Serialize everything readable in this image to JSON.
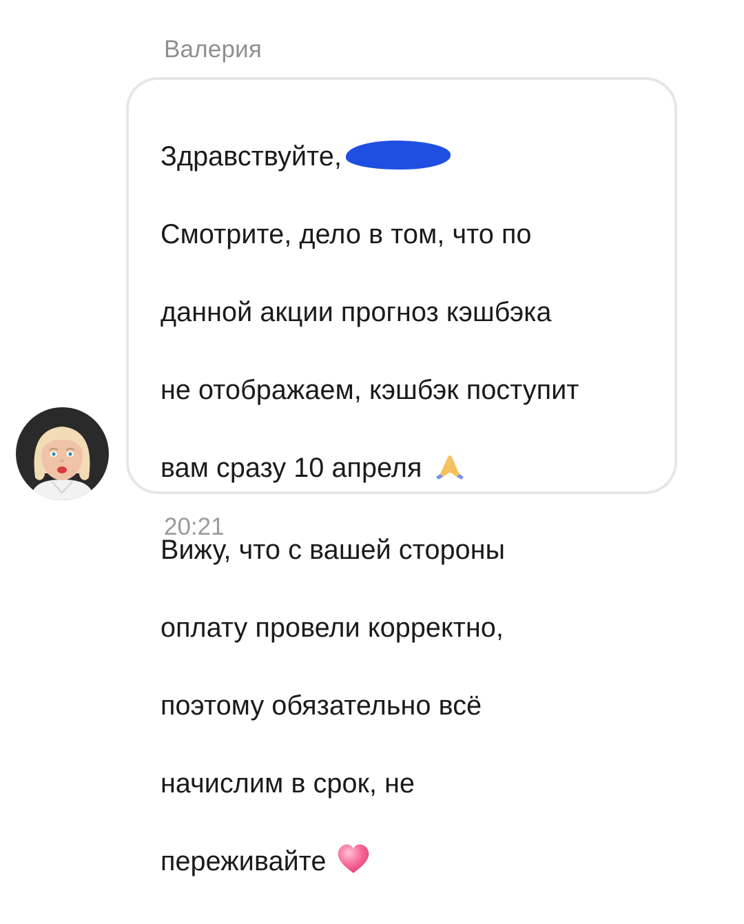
{
  "message": {
    "sender_name": "Валерия",
    "greeting": "Здравствуйте,",
    "lines": [
      "Смотрите, дело в том, что по",
      "данной акции прогноз кэшбэка",
      "не отображаем, кэшбэк поступит",
      "вам сразу 10 апреля",
      "Вижу, что с вашей стороны",
      "оплату провели корректно,",
      "поэтому обязательно всё",
      "начислим в срок, не",
      "переживайте"
    ],
    "time": "20:21",
    "redaction_color": "#1f4fe0",
    "icons": {
      "line4_emoji": "folded-hands-icon",
      "line9_emoji": "pink-heart-icon",
      "avatar": "avatar"
    }
  }
}
